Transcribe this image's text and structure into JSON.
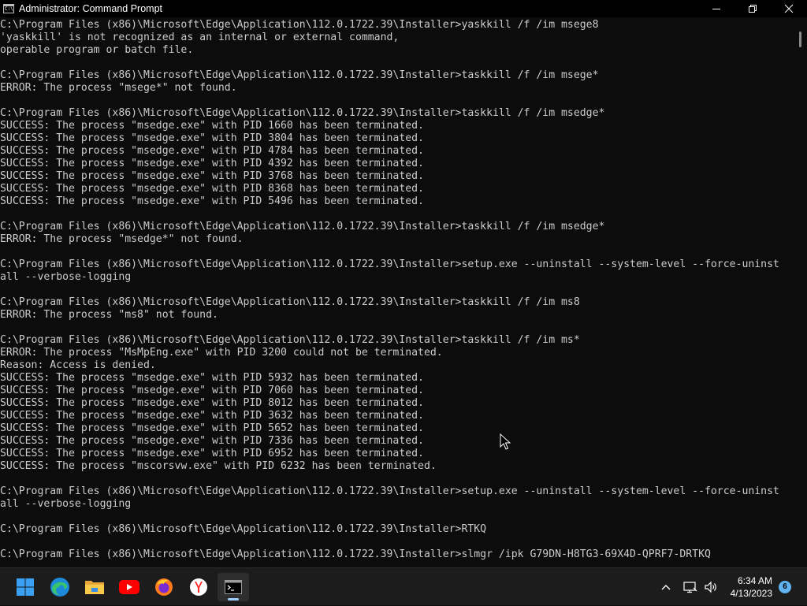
{
  "window": {
    "title": "Administrator: Command Prompt",
    "icon_name": "cmd-app-icon"
  },
  "controls": {
    "minimize": "minimize-icon",
    "maximize": "maximize-icon",
    "close": "close-icon"
  },
  "console": {
    "lines": [
      "C:\\Program Files (x86)\\Microsoft\\Edge\\Application\\112.0.1722.39\\Installer>yaskkill /f /im msege8",
      "'yaskkill' is not recognized as an internal or external command,",
      "operable program or batch file.",
      "",
      "C:\\Program Files (x86)\\Microsoft\\Edge\\Application\\112.0.1722.39\\Installer>taskkill /f /im msege*",
      "ERROR: The process \"msege*\" not found.",
      "",
      "C:\\Program Files (x86)\\Microsoft\\Edge\\Application\\112.0.1722.39\\Installer>taskkill /f /im msedge*",
      "SUCCESS: The process \"msedge.exe\" with PID 1660 has been terminated.",
      "SUCCESS: The process \"msedge.exe\" with PID 3804 has been terminated.",
      "SUCCESS: The process \"msedge.exe\" with PID 4784 has been terminated.",
      "SUCCESS: The process \"msedge.exe\" with PID 4392 has been terminated.",
      "SUCCESS: The process \"msedge.exe\" with PID 3768 has been terminated.",
      "SUCCESS: The process \"msedge.exe\" with PID 8368 has been terminated.",
      "SUCCESS: The process \"msedge.exe\" with PID 5496 has been terminated.",
      "",
      "C:\\Program Files (x86)\\Microsoft\\Edge\\Application\\112.0.1722.39\\Installer>taskkill /f /im msedge*",
      "ERROR: The process \"msedge*\" not found.",
      "",
      "C:\\Program Files (x86)\\Microsoft\\Edge\\Application\\112.0.1722.39\\Installer>setup.exe --uninstall --system-level --force-uninst",
      "all --verbose-logging",
      "",
      "C:\\Program Files (x86)\\Microsoft\\Edge\\Application\\112.0.1722.39\\Installer>taskkill /f /im ms8",
      "ERROR: The process \"ms8\" not found.",
      "",
      "C:\\Program Files (x86)\\Microsoft\\Edge\\Application\\112.0.1722.39\\Installer>taskkill /f /im ms*",
      "ERROR: The process \"MsMpEng.exe\" with PID 3200 could not be terminated.",
      "Reason: Access is denied.",
      "SUCCESS: The process \"msedge.exe\" with PID 5932 has been terminated.",
      "SUCCESS: The process \"msedge.exe\" with PID 7060 has been terminated.",
      "SUCCESS: The process \"msedge.exe\" with PID 8012 has been terminated.",
      "SUCCESS: The process \"msedge.exe\" with PID 3632 has been terminated.",
      "SUCCESS: The process \"msedge.exe\" with PID 5652 has been terminated.",
      "SUCCESS: The process \"msedge.exe\" with PID 7336 has been terminated.",
      "SUCCESS: The process \"msedge.exe\" with PID 6952 has been terminated.",
      "SUCCESS: The process \"mscorsvw.exe\" with PID 6232 has been terminated.",
      "",
      "C:\\Program Files (x86)\\Microsoft\\Edge\\Application\\112.0.1722.39\\Installer>setup.exe --uninstall --system-level --force-uninst",
      "all --verbose-logging",
      "",
      "C:\\Program Files (x86)\\Microsoft\\Edge\\Application\\112.0.1722.39\\Installer>RTKQ",
      "",
      "C:\\Program Files (x86)\\Microsoft\\Edge\\Application\\112.0.1722.39\\Installer>slmgr /ipk G79DN-H8TG3-69X4D-QPRF7-DRTKQ"
    ]
  },
  "taskbar": {
    "apps": [
      {
        "name": "start-button",
        "icon": "windows-logo-icon"
      },
      {
        "name": "taskbar-edge",
        "icon": "edge-icon"
      },
      {
        "name": "taskbar-file-explorer",
        "icon": "folder-icon"
      },
      {
        "name": "taskbar-youtube",
        "icon": "youtube-icon"
      },
      {
        "name": "taskbar-firefox",
        "icon": "firefox-icon"
      },
      {
        "name": "taskbar-yandex",
        "icon": "yandex-browser-icon"
      },
      {
        "name": "taskbar-command-prompt",
        "icon": "cmd-icon",
        "active": true
      }
    ],
    "tray": {
      "chevron": "chevron-up-icon",
      "network": "network-icon",
      "volume": "volume-icon"
    },
    "clock": {
      "time": "6:34 AM",
      "date": "4/13/2023"
    },
    "notification_count": "6"
  },
  "colors": {
    "console_bg": "#0c0c0c",
    "console_text": "#cccccc",
    "taskbar_bg": "#1c1c1c",
    "accent": "#5eb3f0"
  }
}
